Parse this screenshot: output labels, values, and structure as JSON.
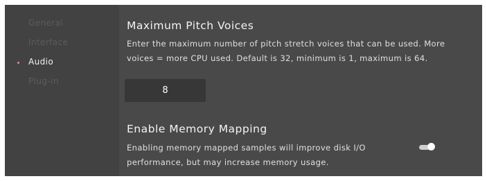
{
  "sidebar": {
    "items": [
      {
        "label": "General",
        "active": false
      },
      {
        "label": "Interface",
        "active": false
      },
      {
        "label": "Audio",
        "active": true
      },
      {
        "label": "Plug-in",
        "active": false
      }
    ],
    "active_indicator_color": "#d987b8"
  },
  "settings": {
    "pitch_voices": {
      "title": "Maximum Pitch Voices",
      "description": "Enter the maximum number of pitch stretch voices that can be used. More voices = more CPU used. Default is 32, minimum is 1, maximum is 64.",
      "value": "8"
    },
    "memory_mapping": {
      "title": "Enable Memory Mapping",
      "description": "Enabling memory mapped samples will improve disk I/O performance, but may increase memory usage.",
      "enabled": true
    }
  },
  "colors": {
    "panel_background": "#494949",
    "sidebar_background": "#424242",
    "input_background": "#373737",
    "text_primary": "#f4f4f4",
    "text_inactive": "#5c5c5c"
  }
}
